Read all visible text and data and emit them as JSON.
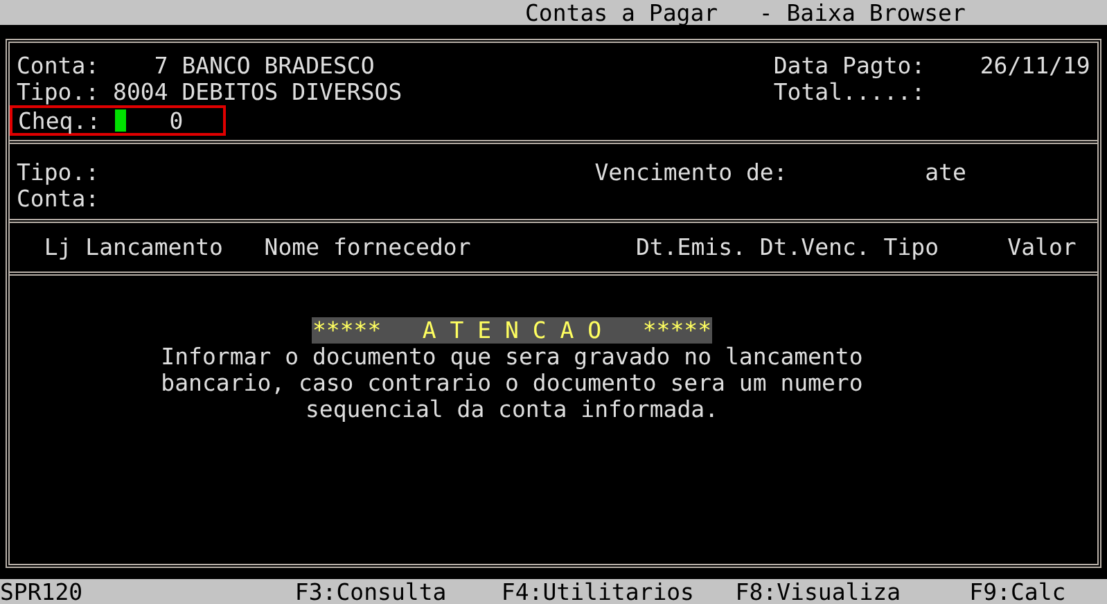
{
  "window": {
    "title": "Contas a Pagar   - Baixa Browser"
  },
  "header": {
    "left": [
      {
        "label": "Conta:",
        "code": "7",
        "name": "BANCO BRADESCO"
      },
      {
        "label": "Tipo.:",
        "code": "8004",
        "name": "DEBITOS DIVERSOS"
      }
    ],
    "right": [
      {
        "label": "Data Pagto:",
        "value": "26/11/19"
      },
      {
        "label": "Total.....:"
      }
    ],
    "cheque": {
      "label": "Cheq.:",
      "value": "0",
      "cursor": true,
      "highlighted": true
    }
  },
  "filters": {
    "tipo": "Tipo.:",
    "conta": "Conta:",
    "vencimento": "Vencimento de:",
    "ate": "ate"
  },
  "table": {
    "columns": [
      "Lj",
      "Lancamento",
      "Nome fornecedor",
      "Dt.Emis.",
      "Dt.Venc.",
      "Tipo",
      "Valor"
    ]
  },
  "alert": {
    "banner": "*****   A T E N C A O   *****",
    "lines": [
      "Informar o documento que sera gravado no lancamento",
      "bancario, caso contrario o documento sera um numero",
      "sequencial da conta informada."
    ]
  },
  "status_bar": {
    "program": "SPR120",
    "keys": [
      "F3:Consulta",
      "F4:Utilitarios",
      "F8:Visualiza",
      "F9:Calc"
    ]
  }
}
